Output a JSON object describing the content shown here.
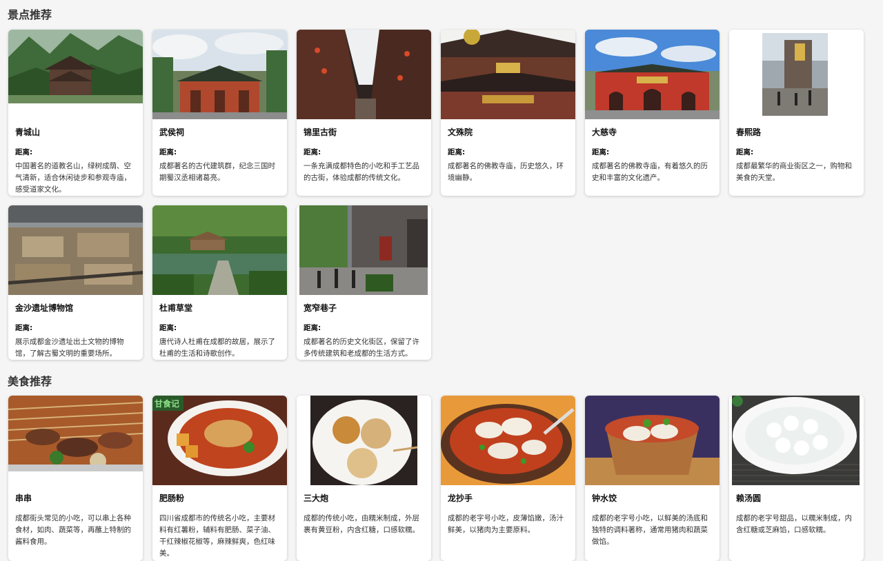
{
  "sections": {
    "attractions_title": "景点推荐",
    "food_title": "美食推荐"
  },
  "distance_label": "距离:",
  "attractions": [
    {
      "name": "青城山",
      "desc": "中国著名的道教名山，绿树成荫、空气清新，适合休闲徒步和参观寺庙，感受道家文化。",
      "image": "mountain-temple-photo"
    },
    {
      "name": "武侯祠",
      "desc": "成都著名的古代建筑群，纪念三国时期蜀汉丞相诸葛亮。",
      "image": "shrine-gate-photo"
    },
    {
      "name": "锦里古街",
      "desc": "一条充满成都特色的小吃和手工艺品的古街，体验成都的传统文化。",
      "image": "ancient-street-photo"
    },
    {
      "name": "文殊院",
      "desc": "成都著名的佛教寺庙，历史悠久，环境幽静。",
      "image": "monastery-photo"
    },
    {
      "name": "大慈寺",
      "desc": "成都著名的佛教寺庙，有着悠久的历史和丰富的文化遗产。",
      "image": "temple-red-wall-photo"
    },
    {
      "name": "春熙路",
      "desc": "成都最繁华的商业街区之一，购物和美食的天堂。",
      "image": "shopping-street-photo"
    },
    {
      "name": "金沙遗址博物馆",
      "desc": "展示成都金沙遗址出土文物的博物馆，了解古蜀文明的重要场所。",
      "image": "museum-excavation-photo"
    },
    {
      "name": "杜甫草堂",
      "desc": "唐代诗人杜甫在成都的故居，展示了杜甫的生活和诗歌创作。",
      "image": "thatched-cottage-photo"
    },
    {
      "name": "宽窄巷子",
      "desc": "成都著名的历史文化街区，保留了许多传统建筑和老成都的生活方式。",
      "image": "alley-photo"
    }
  ],
  "foods": [
    {
      "name": "串串",
      "desc": "成都街头常见的小吃，可以串上各种食材，如肉、蔬菜等，再蘸上特制的酱料食用。",
      "image": "skewers-photo"
    },
    {
      "name": "肥肠粉",
      "desc": "四川省成都市的传统名小吃，主要材料有红薯粉，辅料有肥肠、菜子油、干红辣椒花椒等，麻辣鲜爽，色红味美。",
      "image": "noodle-bowl-photo",
      "img_badge": "甘食记"
    },
    {
      "name": "三大炮",
      "desc": "成都的传统小吃，由糯米制成，外层裹有黄豆粉，内含红糖，口感软糯。",
      "image": "rice-balls-photo"
    },
    {
      "name": "龙抄手",
      "desc": "成都的老字号小吃，皮薄馅嫩，汤汁鲜美，以猪肉为主要原料。",
      "image": "wonton-photo"
    },
    {
      "name": "钟水饺",
      "desc": "成都的老字号小吃，以鲜美的汤底和独特的调料著称，通常用猪肉和蔬菜做馅。",
      "image": "dumplings-photo"
    },
    {
      "name": "赖汤圆",
      "desc": "成都的老字号甜品，以糯米制成，内含红糖或芝麻馅，口感软糯。",
      "image": "tangyuan-photo"
    }
  ]
}
